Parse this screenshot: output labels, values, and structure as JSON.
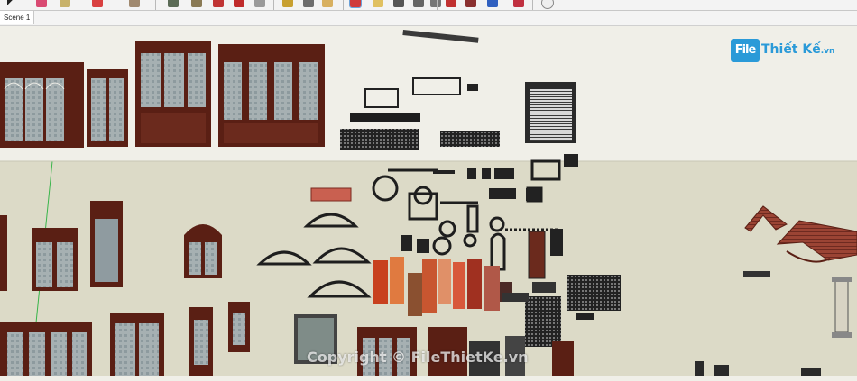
{
  "app": {
    "scene_tab": "Scene 1"
  },
  "toolbar": {
    "icons": [
      "select-arrow-icon",
      "eraser-icon",
      "pencil-icon",
      "line-icon",
      "paint-icon",
      "push-pull-icon",
      "move-icon",
      "rotate-icon",
      "offset-icon",
      "tape-measure-icon",
      "dimension-icon",
      "protractor-icon",
      "text-icon",
      "axes-icon",
      "3d-text-icon",
      "orbit-icon",
      "pan-icon",
      "zoom-icon",
      "zoom-extents-icon",
      "warehouse-icon",
      "extension-icon",
      "component-icon",
      "sandbox-icon",
      "add-location-icon"
    ]
  },
  "logo": {
    "box_text": "File",
    "main_text": "Thiết Kế",
    "suffix": ".vn"
  },
  "watermark": {
    "text": "Copyright © FileThietKe.vn"
  },
  "colors": {
    "sky": "#f0efe8",
    "ground": "#dcdac7",
    "frame": "#5a1f14",
    "glass": "#9aa7ad",
    "logo_blue": "#2a9ad8"
  }
}
